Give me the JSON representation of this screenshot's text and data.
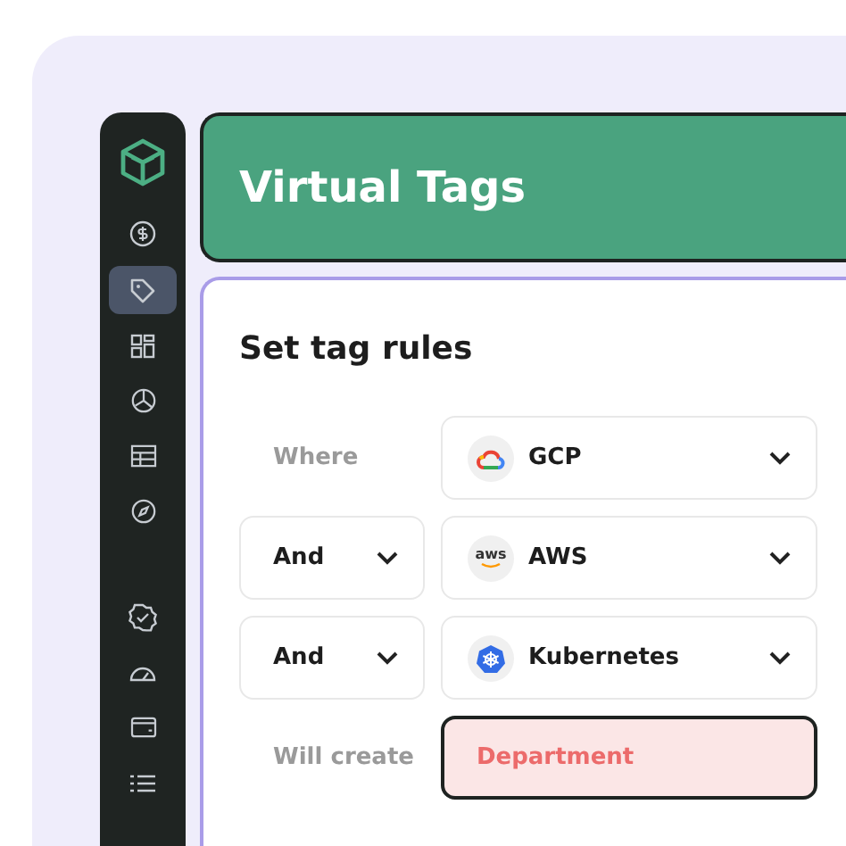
{
  "sidebar": {
    "items": [
      {
        "selected": false
      },
      {
        "selected": true
      },
      {
        "selected": false
      },
      {
        "selected": false
      },
      {
        "selected": false
      },
      {
        "selected": false
      },
      {
        "selected": false
      },
      {
        "selected": false
      },
      {
        "selected": false
      },
      {
        "selected": false
      }
    ]
  },
  "header": {
    "title": "Virtual Tags"
  },
  "card": {
    "title": "Set tag rules",
    "rules": [
      {
        "operator": {
          "kind": "text",
          "label": "Where"
        },
        "source": {
          "kind": "select",
          "value": "GCP"
        }
      },
      {
        "operator": {
          "kind": "select",
          "label": "And"
        },
        "source": {
          "kind": "select",
          "value": "AWS",
          "logo_text": "aws"
        }
      },
      {
        "operator": {
          "kind": "select",
          "label": "And"
        },
        "source": {
          "kind": "select",
          "value": "Kubernetes"
        }
      },
      {
        "operator": {
          "kind": "text",
          "label": "Will create"
        },
        "source": {
          "kind": "output",
          "value": "Department"
        }
      }
    ]
  }
}
